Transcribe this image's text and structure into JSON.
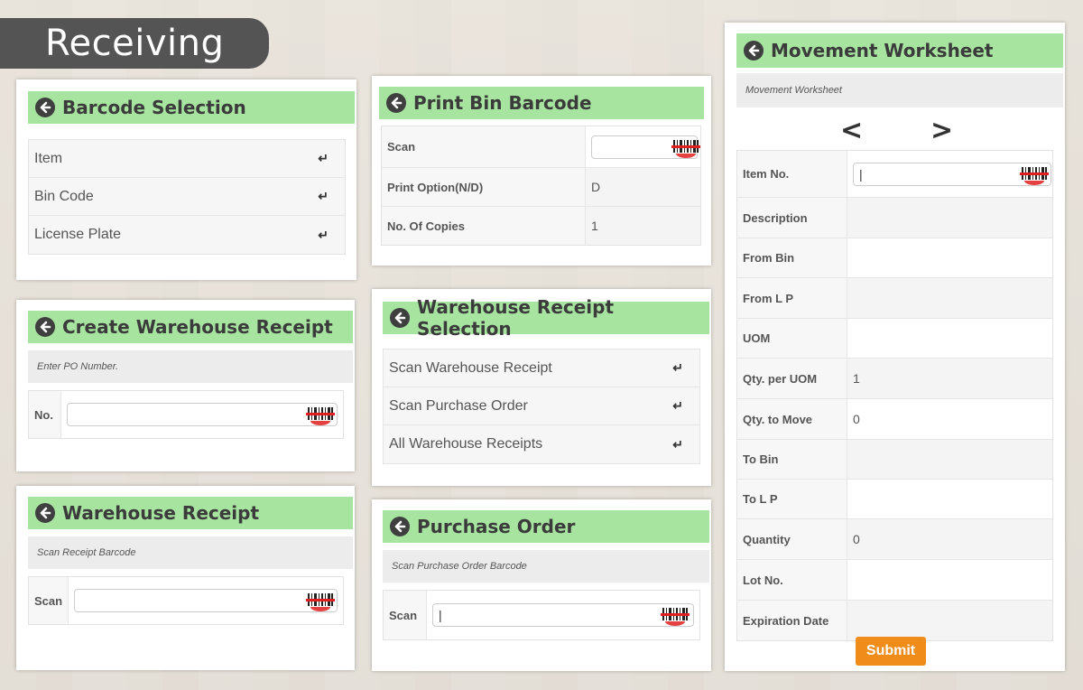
{
  "page": {
    "title": "Receiving"
  },
  "barcode_selection": {
    "title": "Barcode Selection",
    "items": [
      {
        "label": "Item"
      },
      {
        "label": "Bin Code"
      },
      {
        "label": "License Plate"
      }
    ]
  },
  "create_warehouse_receipt": {
    "title": "Create Warehouse Receipt",
    "subtitle": "Enter PO Number.",
    "no_label": "No.",
    "no_value": ""
  },
  "warehouse_receipt": {
    "title": "Warehouse Receipt",
    "subtitle": "Scan Receipt Barcode",
    "scan_label": "Scan",
    "scan_value": ""
  },
  "print_bin_barcode": {
    "title": "Print Bin Barcode",
    "rows": [
      {
        "label": "Scan",
        "value": ""
      },
      {
        "label": "Print Option(N/D)",
        "value": "D"
      },
      {
        "label": "No. Of Copies",
        "value": "1"
      }
    ]
  },
  "warehouse_receipt_selection": {
    "title": "Warehouse Receipt Selection",
    "items": [
      {
        "label": "Scan Warehouse Receipt"
      },
      {
        "label": "Scan Purchase Order"
      },
      {
        "label": "All Warehouse Receipts"
      }
    ]
  },
  "purchase_order": {
    "title": "Purchase Order",
    "subtitle": "Scan Purchase Order Barcode",
    "scan_label": "Scan",
    "scan_value": "|"
  },
  "movement_worksheet": {
    "title": "Movement Worksheet",
    "subtitle": "Movement Worksheet",
    "prev": "<",
    "next": ">",
    "rows": [
      {
        "label": "Item No.",
        "value": "|"
      },
      {
        "label": "Description",
        "value": ""
      },
      {
        "label": "From Bin",
        "value": ""
      },
      {
        "label": "From L P",
        "value": ""
      },
      {
        "label": "UOM",
        "value": ""
      },
      {
        "label": "Qty. per UOM",
        "value": "1"
      },
      {
        "label": "Qty. to Move",
        "value": "0"
      },
      {
        "label": "To Bin",
        "value": ""
      },
      {
        "label": "To L P",
        "value": ""
      },
      {
        "label": "Quantity",
        "value": "0"
      },
      {
        "label": "Lot No.",
        "value": ""
      },
      {
        "label": "Expiration Date",
        "value": ""
      }
    ],
    "submit_label": "Submit"
  },
  "icons": {
    "back": "circle-arrow-left-icon",
    "enter": "enter-return-icon",
    "barcode": "barcode-scanner-icon"
  },
  "colors": {
    "header_green": "#a6e4a0",
    "title_banner": "#545454",
    "submit": "#f08c1a",
    "barcode_red": "#e02020"
  }
}
